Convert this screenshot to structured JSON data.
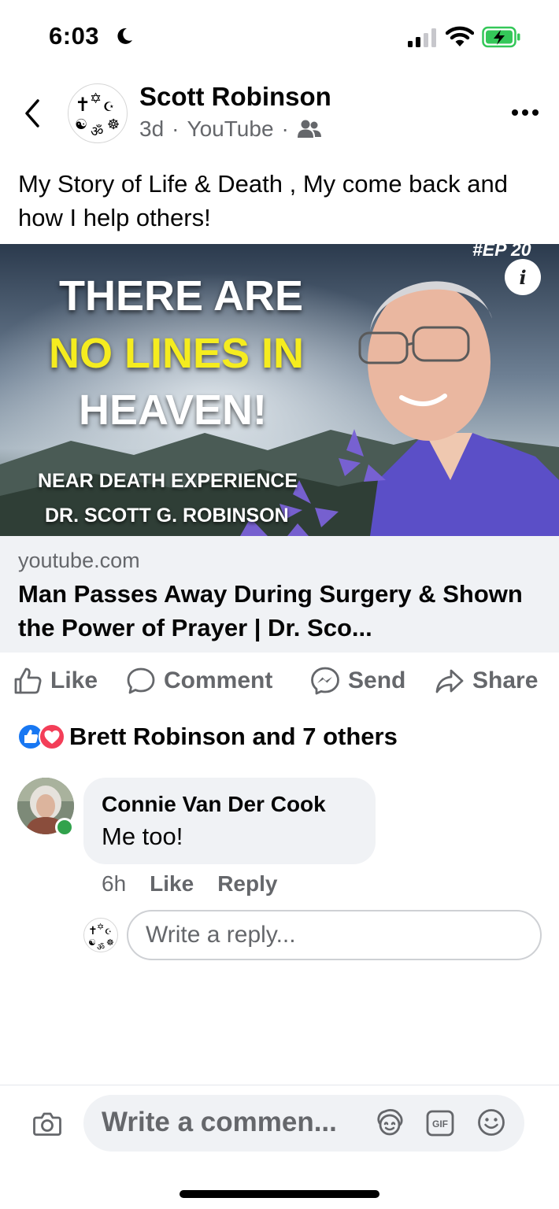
{
  "status_bar": {
    "time": "6:03",
    "icons": [
      "moon-icon",
      "cellular-signal-icon",
      "wifi-icon",
      "battery-charging-icon"
    ]
  },
  "post": {
    "author": "Scott Robinson",
    "age": "3d",
    "source": "YouTube",
    "separator": "·",
    "audience_icon": "friends-icon",
    "text": "My Story of Life & Death , My come back and how I help others!",
    "thumbnail": {
      "line1": "THERE ARE",
      "line2": "NO LINES IN",
      "line3": "HEAVEN!",
      "sub1": "NEAR DEATH EXPERIENCE",
      "sub2": "DR. SCOTT G. ROBINSON",
      "episode": "#EP 20",
      "info_label": "i",
      "highlight_color": "#f5ec1f"
    },
    "link": {
      "domain": "youtube.com",
      "title": "Man Passes Away During Surgery & Shown the Power of Prayer | Dr. Sco..."
    }
  },
  "actions": {
    "like": "Like",
    "comment": "Comment",
    "send": "Send",
    "share": "Share"
  },
  "reactions": {
    "summary": "Brett Robinson and 7 others",
    "types": [
      "like-reaction-icon",
      "love-reaction-icon"
    ]
  },
  "comment": {
    "author": "Connie Van Der Cook",
    "text": "Me too!",
    "time": "6h",
    "like_label": "Like",
    "reply_label": "Reply"
  },
  "reply_box": {
    "placeholder": "Write a reply..."
  },
  "composer": {
    "placeholder": "Write a commen..."
  },
  "colors": {
    "secondary_text": "#65676b",
    "bubble_bg": "#f0f2f5",
    "like_blue": "#1877f2",
    "love_red": "#f33e58",
    "online_green": "#31a24c"
  }
}
